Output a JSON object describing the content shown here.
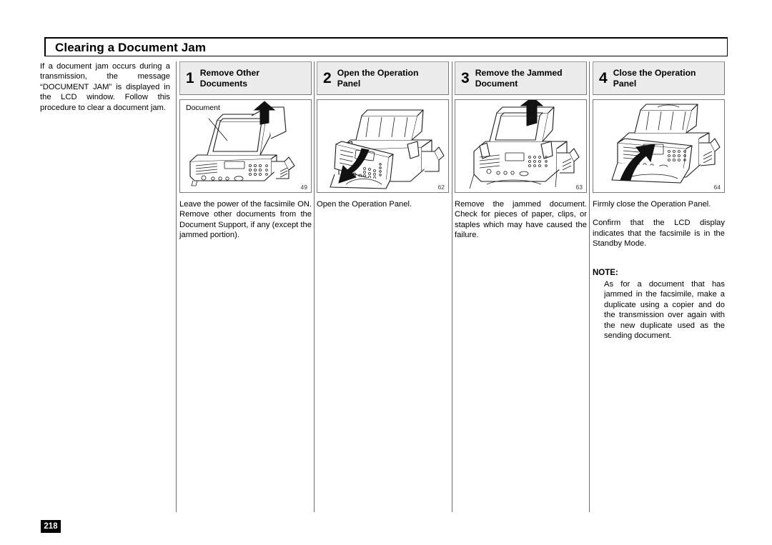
{
  "document": {
    "title": "Clearing a Document Jam",
    "page_number": "218",
    "intro": "If a document jam occurs during a transmission, the message “DOCUMENT JAM” is displayed in the LCD window.  Follow this procedure to clear a document jam."
  },
  "steps": [
    {
      "number": "1",
      "heading": "Remove Other Documents",
      "figure_number": "49",
      "figure_callout": "Document",
      "figure_alt": "Facsimile machine with document being lifted from the document support, upward arrow",
      "caption": "Leave the power of the facsimile ON. Remove other documents from the Document Support, if any (except the jammed portion)."
    },
    {
      "number": "2",
      "heading": "Open the Operation Panel",
      "figure_number": "62",
      "figure_callout": "",
      "figure_alt": "Facsimile machine with the operation panel swinging open downward, curved arrow",
      "caption": "Open the Operation Panel."
    },
    {
      "number": "3",
      "heading": "Remove the Jammed Document",
      "figure_number": "63",
      "figure_callout": "",
      "figure_alt": "Facsimile machine with jammed document being pulled upward out of the feeder, upward arrow",
      "caption": "Remove the jammed document. Check for pieces of paper, clips, or staples which may have caused the failure."
    },
    {
      "number": "4",
      "heading": "Close the Operation Panel",
      "figure_number": "64",
      "figure_callout": "",
      "figure_alt": "Facsimile machine with the operation panel being closed upward, curved arrow",
      "caption": "Firmly close the Operation Panel.",
      "caption2": "Confirm that the LCD display indicates that the facsimile is in the Standby Mode.",
      "note_title": "NOTE:",
      "note_body": "As for a document that has jammed in the facsimile, make a duplicate using a copier and do the transmission over again with the new duplicate used as the sending document."
    }
  ],
  "colors": {
    "step_header_fill": "#ececec",
    "rule": "#6d6d6d",
    "text": "#000000",
    "page_badge_bg": "#000000",
    "page_badge_fg": "#ffffff"
  }
}
